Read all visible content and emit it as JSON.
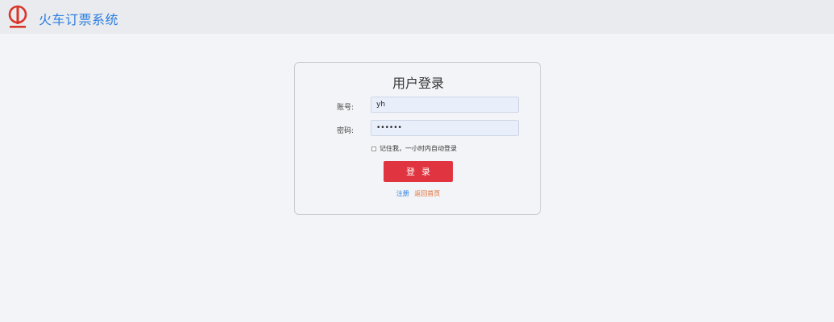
{
  "header": {
    "app_title": "火车订票系统",
    "logo_icon": "railway-logo-icon",
    "logo_color": "#d9362b",
    "title_color": "#2b7de1"
  },
  "login": {
    "title": "用户登录",
    "account_label": "账号:",
    "account_value": "yh",
    "password_label": "密码:",
    "password_value": "••••••",
    "remember_label": "记住我，一小时内自动登录",
    "remember_checked": false,
    "submit_label": "登录",
    "register_link": "注册",
    "home_link": "返回首页",
    "button_color": "#e03440"
  }
}
